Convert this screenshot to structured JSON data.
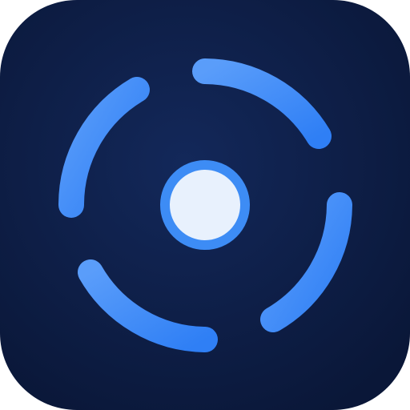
{
  "icon": {
    "depicts": "orbit-ring-icon",
    "colors": {
      "background_center": "#13285a",
      "background_edge": "#0a1738",
      "ring_light": "#5a9dfa",
      "ring_dark": "#2f7ff5",
      "center_fill": "#e8f1fd",
      "center_stroke": "#3d8cf5"
    }
  }
}
